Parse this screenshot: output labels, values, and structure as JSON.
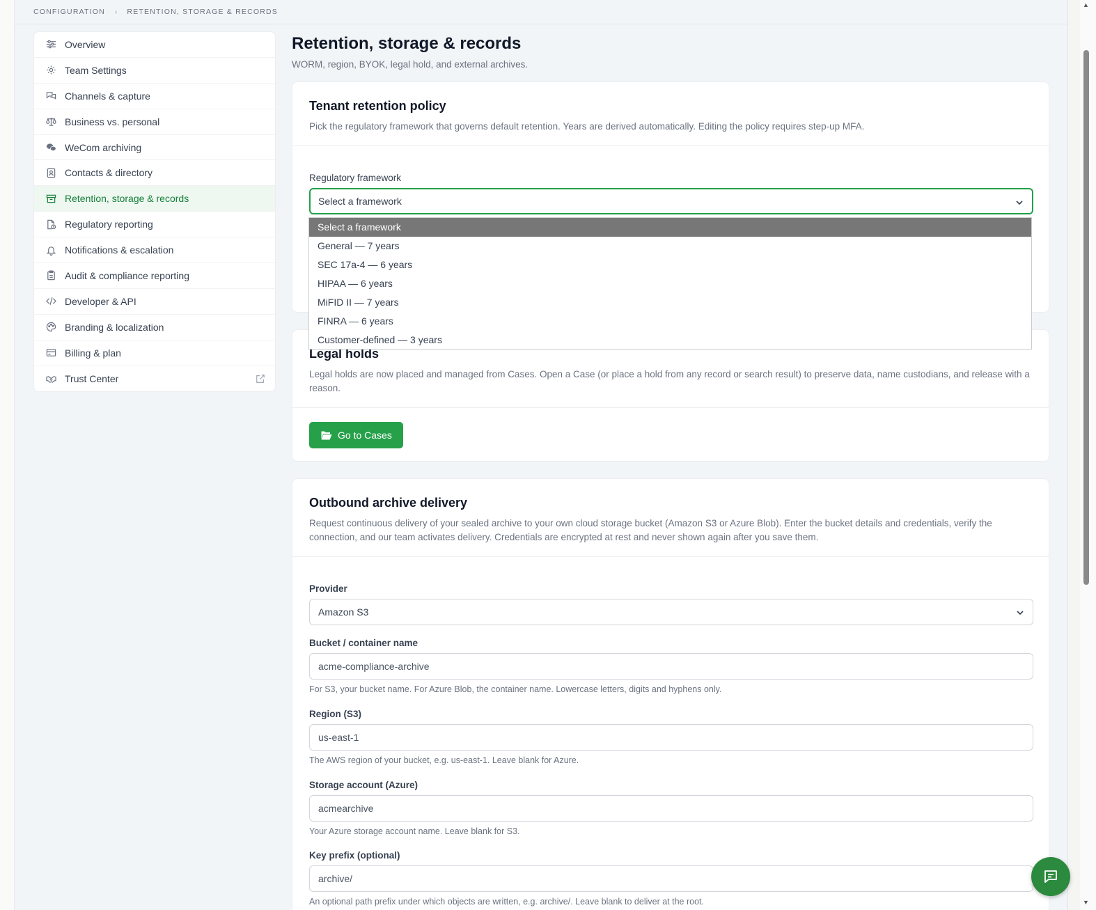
{
  "breadcrumb": {
    "root": "Configuration",
    "current": "Retention, storage & records"
  },
  "sidebar": {
    "items": [
      {
        "label": "Overview",
        "icon": "sliders-icon"
      },
      {
        "label": "Team Settings",
        "icon": "gear-icon"
      },
      {
        "label": "Channels & capture",
        "icon": "chat-bubbles-icon"
      },
      {
        "label": "Business vs. personal",
        "icon": "scale-icon"
      },
      {
        "label": "WeCom archiving",
        "icon": "wechat-icon"
      },
      {
        "label": "Contacts & directory",
        "icon": "contact-card-icon"
      },
      {
        "label": "Retention, storage & records",
        "icon": "archive-box-icon",
        "active": true
      },
      {
        "label": "Regulatory reporting",
        "icon": "file-clock-icon"
      },
      {
        "label": "Notifications & escalation",
        "icon": "bell-icon"
      },
      {
        "label": "Audit & compliance reporting",
        "icon": "clipboard-icon"
      },
      {
        "label": "Developer & API",
        "icon": "code-icon"
      },
      {
        "label": "Branding & localization",
        "icon": "palette-icon"
      },
      {
        "label": "Billing & plan",
        "icon": "credit-card-icon"
      },
      {
        "label": "Trust Center",
        "icon": "handshake-icon",
        "external_icon": "external-link-icon"
      }
    ]
  },
  "page": {
    "title": "Retention, storage & records",
    "subtitle": "WORM, region, BYOK, legal hold, and external archives."
  },
  "retention": {
    "title": "Tenant retention policy",
    "desc": "Pick the regulatory framework that governs default retention. Years are derived automatically. Editing the policy requires step-up MFA.",
    "framework_label": "Regulatory framework",
    "framework_value": "Select a framework",
    "options": [
      "Select a framework",
      "General — 7 years",
      "SEC 17a-4 — 6 years",
      "HIPAA — 6 years",
      "MiFID II — 7 years",
      "FINRA — 6 years",
      "Customer-defined — 3 years"
    ]
  },
  "legal_holds": {
    "title": "Legal holds",
    "desc": "Legal holds are now placed and managed from Cases. Open a Case (or place a hold from any record or search result) to preserve data, name custodians, and release with a reason.",
    "button": "Go to Cases"
  },
  "outbound": {
    "title": "Outbound archive delivery",
    "desc": "Request continuous delivery of your sealed archive to your own cloud storage bucket (Amazon S3 or Azure Blob). Enter the bucket details and credentials, verify the connection, and our team activates delivery. Credentials are encrypted at rest and never shown again after you save them.",
    "provider_label": "Provider",
    "provider_value": "Amazon S3",
    "bucket_label": "Bucket / container name",
    "bucket_placeholder": "acme-compliance-archive",
    "bucket_hint": "For S3, your bucket name. For Azure Blob, the container name. Lowercase letters, digits and hyphens only.",
    "region_label": "Region (S3)",
    "region_placeholder": "us-east-1",
    "region_hint": "The AWS region of your bucket, e.g. us-east-1. Leave blank for Azure.",
    "storage_label": "Storage account (Azure)",
    "storage_placeholder": "acmearchive",
    "storage_hint": "Your Azure storage account name. Leave blank for S3.",
    "prefix_label": "Key prefix (optional)",
    "prefix_placeholder": "archive/",
    "prefix_hint": "An optional path prefix under which objects are written, e.g. archive/. Leave blank to deliver at the root."
  },
  "colors": {
    "accent": "#27a04a",
    "active_text": "#16803a",
    "active_bg": "#eef7f0"
  }
}
